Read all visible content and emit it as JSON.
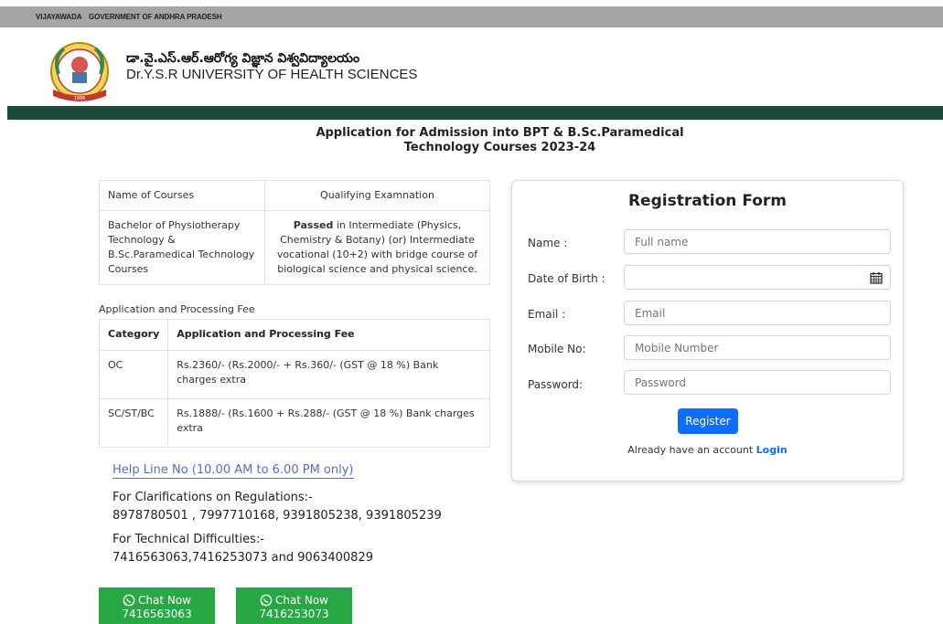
{
  "topbar": {
    "city": "VIJAYAWADA",
    "govt": "GOVERNMENT OF ANDHRA PRADESH"
  },
  "header": {
    "title_telugu": "డా.వై.ఎస్.ఆర్.ఆరోగ్య విజ్ఞాన విశ్వవిద్యాలయం",
    "title_english": "Dr.Y.S.R UNIVERSITY OF HEALTH SCIENCES",
    "logo_year": "1986"
  },
  "page": {
    "title_line1": "Application for Admission into BPT & B.Sc.Paramedical",
    "title_line2": "Technology Courses 2023-24"
  },
  "courses_table": {
    "header_col1": "Name of Courses",
    "header_col2": "Qualifying Examnation",
    "row_course": "Bachelor of Physiotherapy Technology & B.Sc.Paramedical Technology Courses",
    "row_qual_bold": "Passed",
    "row_qual_rest": " in Intermediate (Physics, Chemistry & Botany) (or) Intermediate vocational (10+2) with bridge course of biological science and physical science."
  },
  "fees": {
    "caption": "Application and Processing Fee",
    "header_category": "Category",
    "header_fee": "Application and Processing Fee",
    "rows": [
      {
        "category": "OC",
        "fee": "Rs.2360/- (Rs.2000/- + Rs.360/- (GST @ 18 %) Bank charges extra"
      },
      {
        "category": "SC/ST/BC",
        "fee": "Rs.1888/- (Rs.1600 + Rs.288/- (GST @ 18 %) Bank charges extra"
      }
    ]
  },
  "help": {
    "helpline": "Help Line No (10.00 AM to 6.00 PM only)",
    "regs_label": "For Clarifications on Regulations:-",
    "regs_numbers": "8978780501 , 7997710168, 9391805238, 9391805239",
    "tech_label": "For Technical Difficulties:-",
    "tech_numbers": "7416563063,7416253073 and 9063400829"
  },
  "chat": [
    {
      "label": "Chat Now",
      "number": "7416563063"
    },
    {
      "label": "Chat Now",
      "number": "7416253073"
    }
  ],
  "form": {
    "title": "Registration Form",
    "name_label": "Name :",
    "name_placeholder": "Full name",
    "dob_label": "Date of Birth :",
    "dob_value": "",
    "email_label": "Email :",
    "email_placeholder": "Email",
    "mobile_label": "Mobile No:",
    "mobile_placeholder": "Mobile Number",
    "password_label": "Password:",
    "password_placeholder": "Password",
    "register_label": "Register",
    "have_account": "Already have an account",
    "login_label": "Login"
  },
  "colors": {
    "green_bar": "#1c4a3a",
    "chat_green": "#28a745",
    "primary_blue": "#0d6efd",
    "helpline_blue": "#5a6acf"
  },
  "icons": {
    "calendar": "calendar-icon",
    "whatsapp": "whatsapp-icon",
    "logo": "university-logo"
  }
}
